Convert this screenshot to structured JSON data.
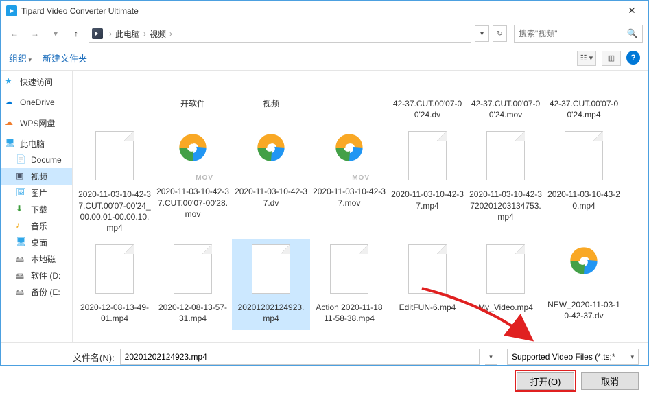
{
  "window": {
    "title": "Tipard Video Converter Ultimate"
  },
  "breadcrumb": {
    "parts": [
      "此电脑",
      "视频"
    ]
  },
  "search": {
    "placeholder": "搜索\"视频\""
  },
  "toolbar": {
    "organize": "组织",
    "newfolder": "新建文件夹"
  },
  "sidebar": {
    "items": [
      {
        "label": "快速访问",
        "icon": "star",
        "indent": 0
      },
      {
        "label": "OneDrive",
        "icon": "cloud",
        "indent": 0
      },
      {
        "label": "WPS网盘",
        "icon": "cloud2",
        "indent": 0
      },
      {
        "label": "此电脑",
        "icon": "pc",
        "indent": 0
      },
      {
        "label": "Docume",
        "icon": "doc",
        "indent": 1
      },
      {
        "label": "视频",
        "icon": "video",
        "indent": 1,
        "selected": true
      },
      {
        "label": "图片",
        "icon": "pic",
        "indent": 1
      },
      {
        "label": "下载",
        "icon": "dl",
        "indent": 1
      },
      {
        "label": "音乐",
        "icon": "music",
        "indent": 1
      },
      {
        "label": "桌面",
        "icon": "desk",
        "indent": 1
      },
      {
        "label": "本地磁",
        "icon": "disk",
        "indent": 1
      },
      {
        "label": "软件 (D:",
        "icon": "disk",
        "indent": 1
      },
      {
        "label": "备份 (E:",
        "icon": "disk",
        "indent": 1
      }
    ]
  },
  "files_top": [
    {
      "name": "开软件",
      "thumb": "none"
    },
    {
      "name": "视频",
      "thumb": "none"
    },
    {
      "name": "42-37.CUT.00'07-00'24.dv",
      "thumb": "none"
    },
    {
      "name": "42-37.CUT.00'07-00'24.mov",
      "thumb": "none"
    },
    {
      "name": "42-37.CUT.00'07-00'24.mp4",
      "thumb": "none"
    }
  ],
  "files_row1": [
    {
      "name": "2020-11-03-10-42-37.CUT.00'07-00'24_00.00.01-00.00.10.mp4",
      "thumb": "page"
    },
    {
      "name": "2020-11-03-10-42-37.CUT.00'07-00'28.mov",
      "thumb": "tencent-mov"
    },
    {
      "name": "2020-11-03-10-42-37.dv",
      "thumb": "tencent"
    },
    {
      "name": "2020-11-03-10-42-37.mov",
      "thumb": "tencent-mov"
    },
    {
      "name": "2020-11-03-10-42-37.mp4",
      "thumb": "page"
    },
    {
      "name": "2020-11-03-10-42-3720201203134753.mp4",
      "thumb": "page"
    },
    {
      "name": "2020-11-03-10-43-20.mp4",
      "thumb": "page"
    }
  ],
  "files_row2": [
    {
      "name": "2020-12-08-13-49-01.mp4",
      "thumb": "page"
    },
    {
      "name": "2020-12-08-13-57-31.mp4",
      "thumb": "page"
    },
    {
      "name": "20201202124923.mp4",
      "thumb": "page",
      "selected": true
    },
    {
      "name": "Action 2020-11-18 11-58-38.mp4",
      "thumb": "page"
    },
    {
      "name": "EditFUN-6.mp4",
      "thumb": "page"
    },
    {
      "name": "My_Video.mp4",
      "thumb": "page"
    },
    {
      "name": "NEW_2020-11-03-10-42-37.dv",
      "thumb": "tencent"
    }
  ],
  "footer": {
    "filename_label": "文件名(N):",
    "filename_value": "20201202124923.mp4",
    "filetype": "Supported Video Files (*.ts;*",
    "open": "打开(O)",
    "cancel": "取消"
  }
}
